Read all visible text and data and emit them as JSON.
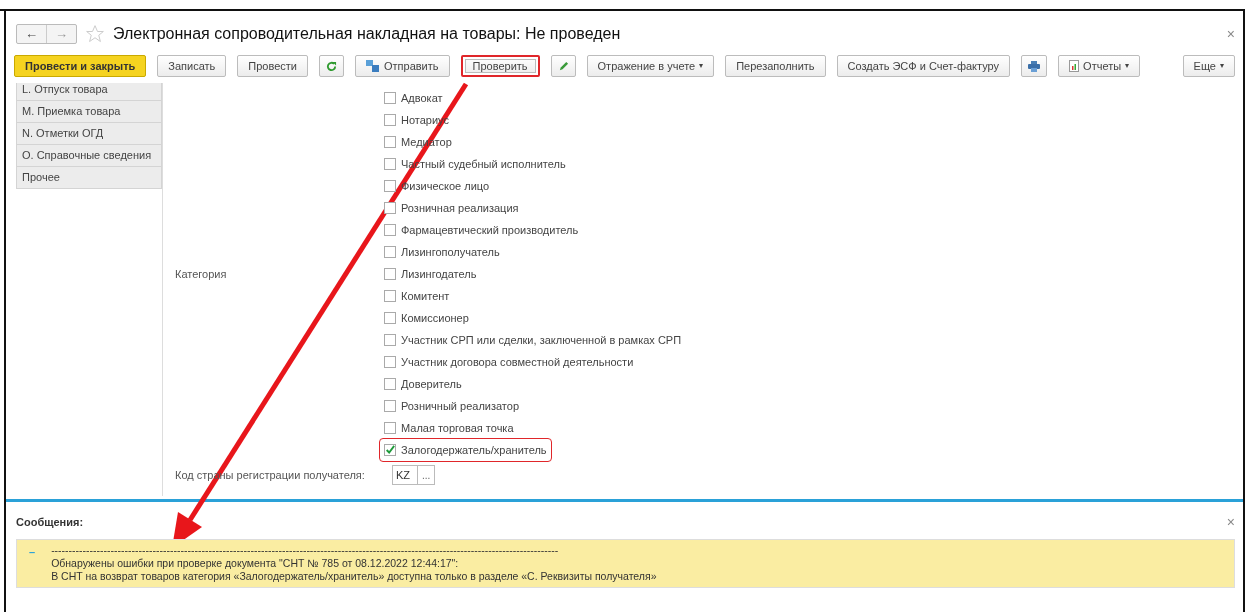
{
  "window": {
    "title": "Электронная сопроводительная накладная на товары: Не проведен",
    "close": "×"
  },
  "nav": {
    "back": "←",
    "forward": "→"
  },
  "toolbar": [
    {
      "kind": "primary",
      "label": "Провести и закрыть",
      "highlighted": false
    },
    {
      "kind": "button",
      "label": "Записать",
      "highlighted": false
    },
    {
      "kind": "button",
      "label": "Провести",
      "highlighted": false
    },
    {
      "kind": "refresh",
      "highlighted": false
    },
    {
      "kind": "send",
      "label": "Отправить",
      "highlighted": false
    },
    {
      "kind": "button",
      "label": "Проверить",
      "highlighted": true
    },
    {
      "kind": "edit",
      "highlighted": false
    },
    {
      "kind": "dropdown",
      "label": "Отражение в учете",
      "caret": "▾",
      "highlighted": false
    },
    {
      "kind": "button",
      "label": "Перезаполнить",
      "highlighted": false
    },
    {
      "kind": "button",
      "label": "Создать ЭСФ и Счет-фактуру",
      "highlighted": false
    },
    {
      "kind": "print",
      "highlighted": false
    },
    {
      "kind": "reports",
      "label": "Отчеты",
      "caret": "▾",
      "highlighted": false
    },
    {
      "kind": "more",
      "label": "Еще",
      "caret": "▾",
      "highlighted": false
    }
  ],
  "sidebar": {
    "items": [
      "L. Отпуск товара",
      "M. Приемка товара",
      "N. Отметки ОГД",
      "O. Справочные сведения",
      "Прочее"
    ]
  },
  "category": {
    "label": "Категория",
    "options": [
      {
        "label": "Адвокат",
        "checked": false,
        "highlighted": false
      },
      {
        "label": "Нотариус",
        "checked": false,
        "highlighted": false
      },
      {
        "label": "Медиатор",
        "checked": false,
        "highlighted": false
      },
      {
        "label": "Частный судебный исполнитель",
        "checked": false,
        "highlighted": false
      },
      {
        "label": "Физическое лицо",
        "checked": false,
        "highlighted": false
      },
      {
        "label": "Розничная реализация",
        "checked": false,
        "highlighted": false
      },
      {
        "label": "Фармацевтический производитель",
        "checked": false,
        "highlighted": false
      },
      {
        "label": "Лизингополучатель",
        "checked": false,
        "highlighted": false
      },
      {
        "label": "Лизингодатель",
        "checked": false,
        "highlighted": false
      },
      {
        "label": "Комитент",
        "checked": false,
        "highlighted": false
      },
      {
        "label": "Комиссионер",
        "checked": false,
        "highlighted": false
      },
      {
        "label": "Участник СРП или сделки, заключенной в рамках СРП",
        "checked": false,
        "highlighted": false
      },
      {
        "label": "Участник договора совместной деятельности",
        "checked": false,
        "highlighted": false
      },
      {
        "label": "Доверитель",
        "checked": false,
        "highlighted": false
      },
      {
        "label": "Розничный реализатор",
        "checked": false,
        "highlighted": false
      },
      {
        "label": "Малая торговая точка",
        "checked": false,
        "highlighted": false
      },
      {
        "label": "Залогодержатель/хранитель",
        "checked": true,
        "highlighted": true
      }
    ]
  },
  "country_field": {
    "label": "Код страны регистрации получателя:",
    "value": "KZ",
    "button": "..."
  },
  "messages": {
    "title": "Сообщения:",
    "close": "×",
    "marker": "–",
    "lines": [
      "-------------------------------------------------------------------------------------------------------------------------------------------------",
      "Обнаружены ошибки при проверке документа \"СНТ № 785 от 08.12.2022 12:44:17\":",
      "В СНТ на возврат товаров категория «Залогодержатель/хранитель» доступна только в разделе «С. Реквизиты получателя»"
    ]
  }
}
